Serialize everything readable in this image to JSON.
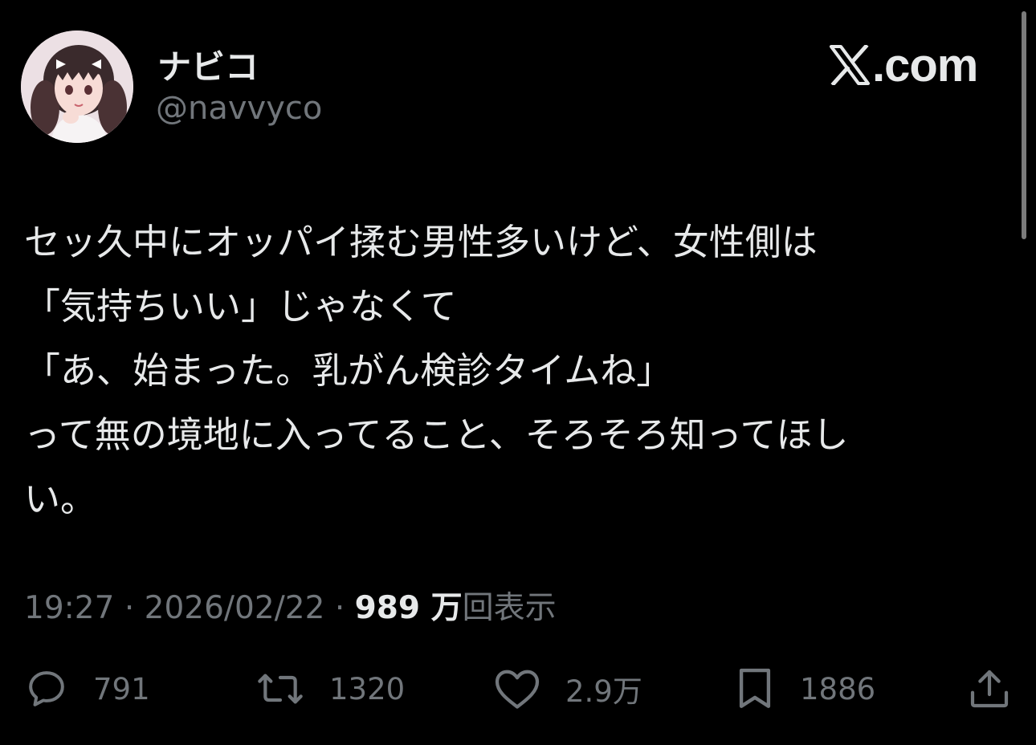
{
  "header": {
    "display_name": "ナビコ",
    "handle": "@navvyco",
    "brand_text": ".com"
  },
  "tweet": {
    "lines": [
      "セッ久中にオッパイ揉む男性多いけど、女性側は",
      "「気持ちいい」じゃなくて",
      "「あ、始まった。乳がん検診タイムね」",
      "って無の境地に入ってること、そろそろ知ってほし",
      "い。"
    ]
  },
  "meta": {
    "time": "19:27",
    "separator": "·",
    "date": "2026/02/22",
    "views_count": "989 万",
    "views_label": "回表示"
  },
  "actions": {
    "replies": "791",
    "reposts": "1320",
    "likes": "2.9万",
    "bookmarks": "1886"
  },
  "icons": {
    "reply": "speech-bubble-icon",
    "repost": "repost-arrows-icon",
    "like": "heart-icon",
    "bookmark": "bookmark-icon",
    "share": "share-upload-icon",
    "brand": "x-logo-icon"
  },
  "colors": {
    "background": "#000000",
    "primary_text": "#e7e9ea",
    "secondary_text": "#71767b"
  }
}
